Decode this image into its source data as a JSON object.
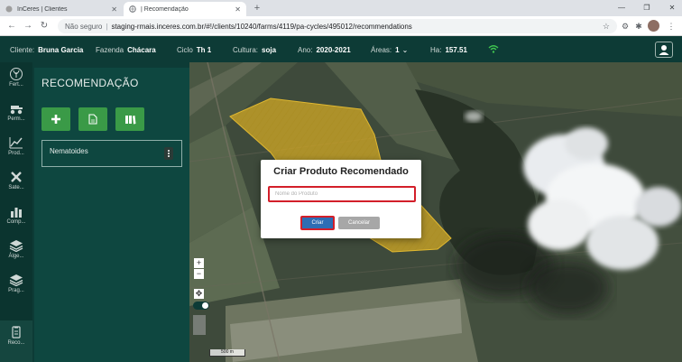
{
  "browser": {
    "tabs": [
      {
        "label": "InCeres | Clientes",
        "active": false
      },
      {
        "label": "| Recomendação",
        "active": true
      }
    ],
    "security_label": "Não seguro",
    "url": "staging-rmais.inceres.com.br/#!/clients/10240/farms/4119/pa-cycles/495012/recommendations"
  },
  "header": {
    "fields": [
      {
        "key": "Cliente:",
        "value": "Bruna Garcia"
      },
      {
        "key": "Fazenda",
        "value": "Chácara"
      },
      {
        "key": "Ciclo",
        "value": "Th 1"
      },
      {
        "key": "Cultura:",
        "value": "soja"
      },
      {
        "key": "Ano:",
        "value": "2020-2021"
      },
      {
        "key": "Áreas:",
        "value": "1"
      },
      {
        "key": "Ha:",
        "value": "157.51"
      }
    ]
  },
  "rail": {
    "items": [
      {
        "label": "Fert...",
        "icon": "plant-icon"
      },
      {
        "label": "Perm...",
        "icon": "tractor-icon"
      },
      {
        "label": "Prod...",
        "icon": "chart-line-icon"
      },
      {
        "label": "Sate...",
        "icon": "satellite-icon"
      },
      {
        "label": "Comp...",
        "icon": "bar-chart-icon"
      },
      {
        "label": "Álge...",
        "icon": "layers-icon"
      },
      {
        "label": "Prag...",
        "icon": "layers-icon"
      },
      {
        "label": "Reco...",
        "icon": "clipboard-icon"
      }
    ]
  },
  "panel": {
    "title": "RECOMENDAÇÃO",
    "card_label": "Nematoides"
  },
  "map": {
    "scale_label": "500 m"
  },
  "modal": {
    "title": "Criar Produto Recomendado",
    "input_placeholder": "Nome do Produto",
    "input_value": "",
    "create_label": "Criar",
    "cancel_label": "Cancelar"
  },
  "colors": {
    "header_bg": "#0d3b36",
    "panel_bg": "#0e4740",
    "action_green": "#3a9a47",
    "field_polygon": "#c9a227",
    "primary_button": "#2e6db4",
    "highlight_red": "#d31f2a"
  }
}
